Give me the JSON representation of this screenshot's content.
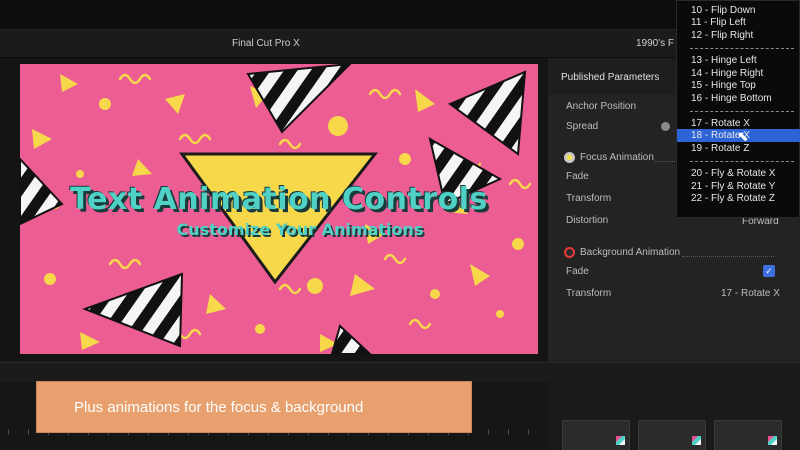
{
  "window": {
    "app_title": "Final Cut Pro X",
    "project_title": "1990's F"
  },
  "canvas": {
    "title": "Text Animation Controls",
    "subtitle": "Customize Your Animations",
    "colors": {
      "background": "#ec5d93",
      "yellow": "#f7d84b",
      "teal": "#4fd1c5"
    }
  },
  "inspector": {
    "header": "Published Parameters",
    "anchor_position_label": "Anchor Position",
    "spread_label": "Spread",
    "focus_section_label": "Focus Animation",
    "focus_fade_label": "Fade",
    "focus_transform_label": "Transform",
    "focus_distortion_label": "Distortion",
    "focus_distortion_value": "Forward",
    "background_section_label": "Background Animation",
    "bg_fade_label": "Fade",
    "bg_fade_checked": true,
    "bg_transform_label": "Transform",
    "bg_transform_value": "17 - Rotate X",
    "check_glyph": "✓"
  },
  "dropdown": {
    "items": [
      "10 - Flip Down",
      "11 - Flip Left",
      "12 - Flip Right",
      "13 - Hinge Left",
      "14 - Hinge Right",
      "15 - Hinge Top",
      "16 - Hinge Bottom",
      "17 - Rotate X",
      "18 - Rotate X",
      "19 - Rotate Z",
      "20 - Fly & Rotate X",
      "21 - Fly & Rotate Y",
      "22 - Fly & Rotate Z"
    ],
    "selected": "18 - Rotate X",
    "highlight_color": "#2e63d6"
  },
  "banner": {
    "text": "Plus animations for the focus & background",
    "color": "#e8a06e"
  }
}
